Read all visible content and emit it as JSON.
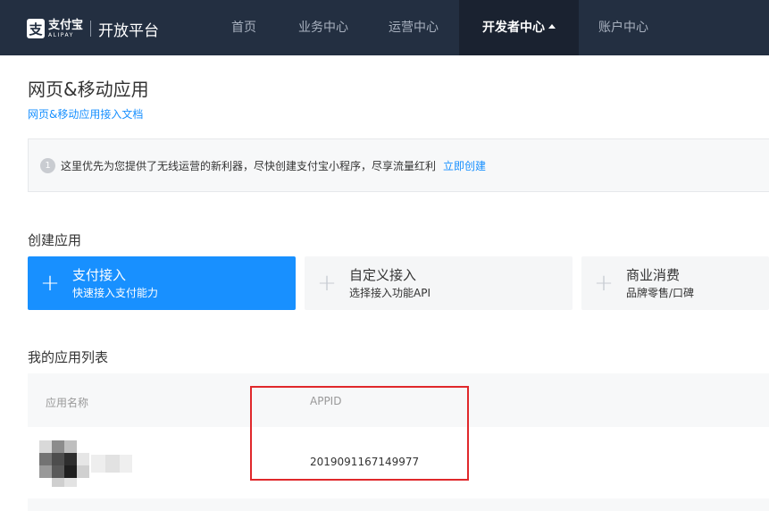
{
  "header": {
    "logo_cn": "支付宝",
    "logo_en": "ALIPAY",
    "product": "开放平台",
    "nav": [
      {
        "label": "首页"
      },
      {
        "label": "业务中心"
      },
      {
        "label": "运营中心"
      },
      {
        "label": "开发者中心",
        "active": true
      },
      {
        "label": "账户中心"
      }
    ]
  },
  "page": {
    "title": "网页&移动应用",
    "doc_link": "网页&移动应用接入文档"
  },
  "notice": {
    "index": "1",
    "text": "这里优先为您提供了无线运营的新利器，尽快创建支付宝小程序，尽享流量红利",
    "link": "立即创建"
  },
  "create": {
    "title": "创建应用",
    "cards": [
      {
        "title": "支付接入",
        "subtitle": "快速接入支付能力"
      },
      {
        "title": "自定义接入",
        "subtitle": "选择接入功能API"
      },
      {
        "title": "商业消费",
        "subtitle": "品牌零售/口碑"
      }
    ]
  },
  "app_list": {
    "title": "我的应用列表",
    "columns": [
      "应用名称",
      "APPID"
    ],
    "rows": [
      {
        "appid": "2019091167149977"
      }
    ]
  },
  "colors": {
    "topbar": "#232f41",
    "primary": "#1890ff",
    "highlight": "#e0282b"
  }
}
